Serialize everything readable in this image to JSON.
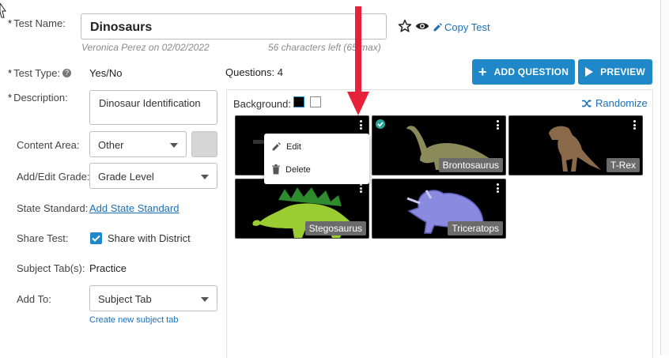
{
  "form": {
    "test_name_label": "Test Name:",
    "test_name_value": "Dinosaurs",
    "author_line": "Veronica Perez on 02/02/2022",
    "chars_left": "56 characters left (65 max)",
    "copy_test_label": "Copy Test",
    "test_type_label": "Test Type:",
    "test_type_value": "Yes/No",
    "description_label": "Description:",
    "description_value": "Dinosaur Identification",
    "content_area_label": "Content Area:",
    "content_area_value": "Other",
    "grade_label": "Add/Edit Grade:",
    "grade_value": "Grade Level",
    "state_standard_label": "State Standard:",
    "state_standard_link": "Add State Standard",
    "share_label": "Share Test:",
    "share_value": "Share with District",
    "share_checked": true,
    "subject_tabs_label": "Subject Tab(s):",
    "subject_tabs_value": "Practice",
    "add_to_label": "Add To:",
    "add_to_value": "Subject Tab",
    "create_tab_link": "Create new subject tab",
    "required_mark": "*"
  },
  "questions": {
    "label": "Questions:",
    "count": "4",
    "add_button": "ADD QUESTION",
    "preview_button": "PREVIEW",
    "background_label": "Background:",
    "randomize_label": "Randomize",
    "tiles": [
      {
        "name": "Stegosaurus"
      },
      {
        "name": "Brontosaurus"
      },
      {
        "name": "T-Rex"
      },
      {
        "name": "Triceratops"
      }
    ]
  },
  "context_menu": {
    "edit": "Edit",
    "delete": "Delete"
  },
  "colors": {
    "accent": "#1e88c9",
    "annotation_arrow": "#e8213a"
  }
}
